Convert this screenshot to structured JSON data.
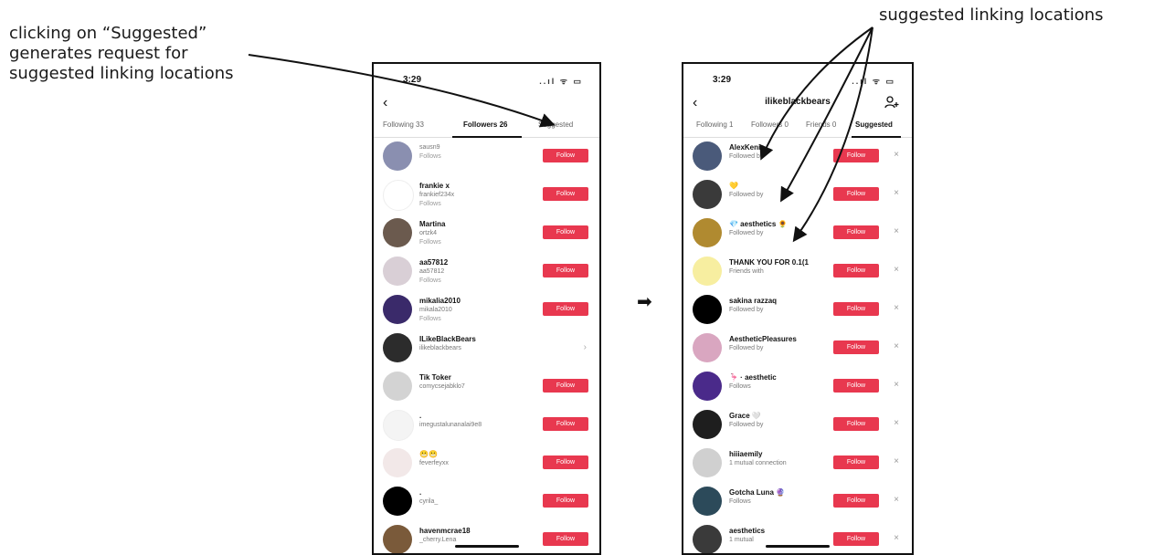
{
  "annotations": {
    "left_lines": [
      "clicking on “Suggested”",
      "generates request for",
      "suggested linking locations"
    ],
    "right": "suggested linking locations"
  },
  "left_phone": {
    "status": {
      "time": "3:29",
      "icons": "..ıl ᯤ ▭"
    },
    "tabs": [
      "Following 33",
      "Followers 26",
      "Suggested"
    ],
    "rows": [
      {
        "name": "",
        "sub": "sausn9",
        "sub2": "Follows",
        "action": "Follow",
        "avatar_color": "#8a8fb0"
      },
      {
        "name": "frankie x",
        "sub": "frankief234x",
        "sub2": "Follows",
        "action": "Follow",
        "avatar_color": "#ffffff"
      },
      {
        "name": "Martina",
        "sub": "ortzk4",
        "sub2": "Follows",
        "action": "Follow",
        "avatar_color": "#6b5a4e"
      },
      {
        "name": "aa57812",
        "sub": "aa57812",
        "sub2": "Follows",
        "action": "Follow",
        "avatar_color": "#d9cfd6"
      },
      {
        "name": "mikalia2010",
        "sub": "mikala2010",
        "sub2": "Follows",
        "action": "Follow",
        "avatar_color": "#3a2a6a"
      },
      {
        "name": "ILikeBlackBears",
        "sub": "ilikeblackbears",
        "sub2": "",
        "action": "",
        "avatar_color": "#2c2c2c"
      },
      {
        "name": "Tik Toker",
        "sub": "comycsejabklo7",
        "sub2": "",
        "action": "Follow",
        "avatar_color": "#d3d3d3"
      },
      {
        "name": ".",
        "sub": "imegustalunanalai9e8",
        "sub2": "",
        "action": "Follow",
        "avatar_color": "#f4f4f4"
      },
      {
        "name": "😬😬",
        "sub": "feverfeyxx",
        "sub2": "",
        "action": "Follow",
        "avatar_color": "#f2e8e8"
      },
      {
        "name": ".",
        "sub": "cyrila_",
        "sub2": "",
        "action": "Follow",
        "avatar_color": "#000000"
      },
      {
        "name": "havenmcrae18",
        "sub": "_cherry.Lena",
        "sub2": "",
        "action": "Follow",
        "avatar_color": "#7a5a3a"
      }
    ]
  },
  "right_phone": {
    "status": {
      "time": "3:29",
      "icons": "..ıl ᯤ ▭"
    },
    "title": "ilikeblackbears",
    "tabs": [
      "Following 1",
      "Followers 0",
      "Friends 0",
      "Suggested"
    ],
    "rows": [
      {
        "name": "AlexKenic",
        "sub": "Followed by",
        "action": "Follow",
        "avatar_color": "#4a5a7a"
      },
      {
        "name": "💛",
        "sub": "Followed by",
        "action": "Follow",
        "avatar_color": "#3a3a3a"
      },
      {
        "name": "💎 aesthetics 🌻",
        "sub": "Followed by",
        "action": "Follow",
        "avatar_color": "#b08a30"
      },
      {
        "name": "THANK YOU FOR 0.1(1",
        "sub": "Friends with",
        "action": "Follow",
        "avatar_color": "#f7eea0"
      },
      {
        "name": "sakina razzaq",
        "sub": "Followed by",
        "action": "Follow",
        "avatar_color": "#000000"
      },
      {
        "name": "AestheticPleasures",
        "sub": "Followed by",
        "action": "Follow",
        "avatar_color": "#d9a6c0"
      },
      {
        "name": "🦩 · aesthetic",
        "sub": "Follows",
        "action": "Follow",
        "avatar_color": "#4a2a8a"
      },
      {
        "name": "Grace 🤍",
        "sub": "Followed by",
        "action": "Follow",
        "avatar_color": "#1e1e1e"
      },
      {
        "name": "hiiiaemily",
        "sub": "1 mutual connection",
        "action": "Follow",
        "avatar_color": "#d0d0d0"
      },
      {
        "name": "Gotcha Luna 🔮",
        "sub": "Follows",
        "action": "Follow",
        "avatar_color": "#2c4a5a"
      },
      {
        "name": "aesthetics",
        "sub": "1 mutual",
        "action": "Follow",
        "avatar_color": "#3a3a3a"
      }
    ]
  }
}
